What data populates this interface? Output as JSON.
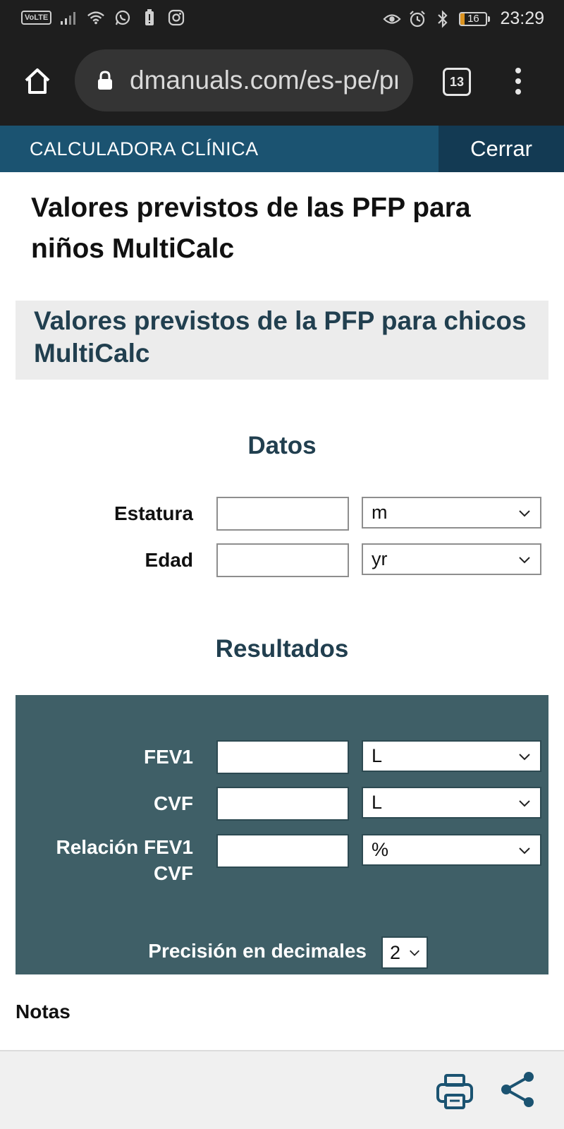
{
  "status_bar": {
    "volte": "VoLTE",
    "battery_level": "16",
    "time": "23:29"
  },
  "browser": {
    "url": "dmanuals.com/es-pe/pro",
    "tab_count": "13"
  },
  "header": {
    "title": "CALCULADORA CLÍNICA",
    "close_label": "Cerrar"
  },
  "page": {
    "title": "Valores previstos de las PFP para niños MultiCalc",
    "section_title": "Valores previstos de la PFP para chicos MultiCalc"
  },
  "datos": {
    "heading": "Datos",
    "fields": [
      {
        "label": "Estatura",
        "value": "",
        "unit": "m"
      },
      {
        "label": "Edad",
        "value": "",
        "unit": "yr"
      }
    ]
  },
  "resultados": {
    "heading": "Resultados",
    "fields": [
      {
        "label": "FEV1",
        "value": "",
        "unit": "L"
      },
      {
        "label": "CVF",
        "value": "",
        "unit": "L"
      },
      {
        "label": "Relación FEV1\nCVF",
        "value": "",
        "unit": "%"
      }
    ],
    "precision_label": "Precisión en decimales",
    "precision_value": "2"
  },
  "notes_label": "Notas",
  "colors": {
    "header_band": "#1b5371",
    "close_button": "#133a53",
    "results_panel": "#3f5f67",
    "heading_text": "#213f4f",
    "icon_accent": "#1b5371"
  },
  "icons": {
    "home": "home-icon",
    "lock": "lock-icon",
    "print": "print-icon",
    "share": "share-icon"
  }
}
